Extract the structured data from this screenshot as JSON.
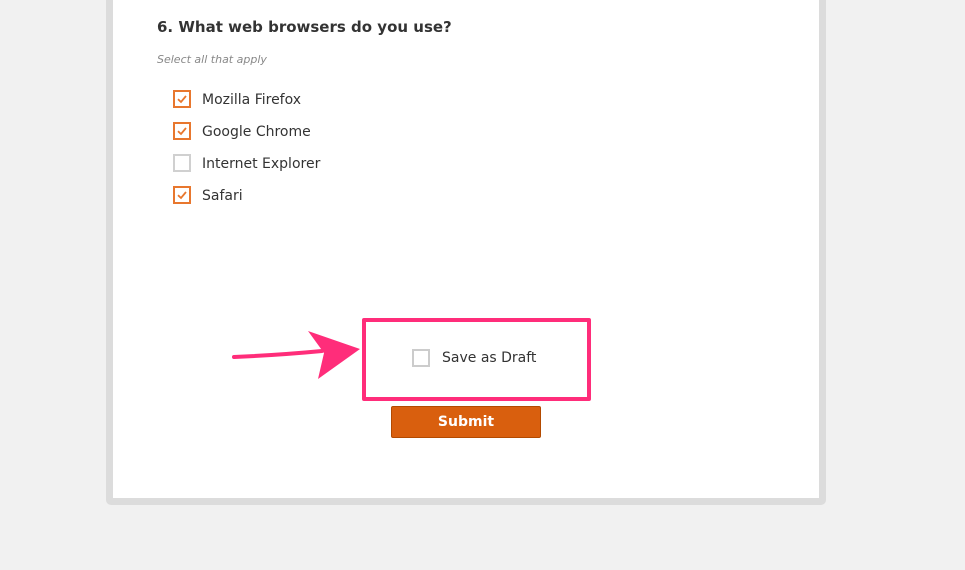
{
  "question": {
    "title": "6. What web browsers do you use?",
    "hint": "Select all that apply",
    "options": [
      {
        "label": "Mozilla Firefox",
        "checked": true
      },
      {
        "label": "Google Chrome",
        "checked": true
      },
      {
        "label": "Internet Explorer",
        "checked": false
      },
      {
        "label": "Safari",
        "checked": true
      }
    ]
  },
  "draft": {
    "label": "Save as Draft",
    "checked": false
  },
  "submit": {
    "label": "Submit"
  },
  "colors": {
    "accent": "#e8772e",
    "submit": "#d95f0e",
    "highlight": "#ff2d7a",
    "page_background": "#f1f1f1"
  },
  "annotation": {
    "arrow_icon": "pointer-arrow-icon",
    "highlight": "highlight-box"
  }
}
